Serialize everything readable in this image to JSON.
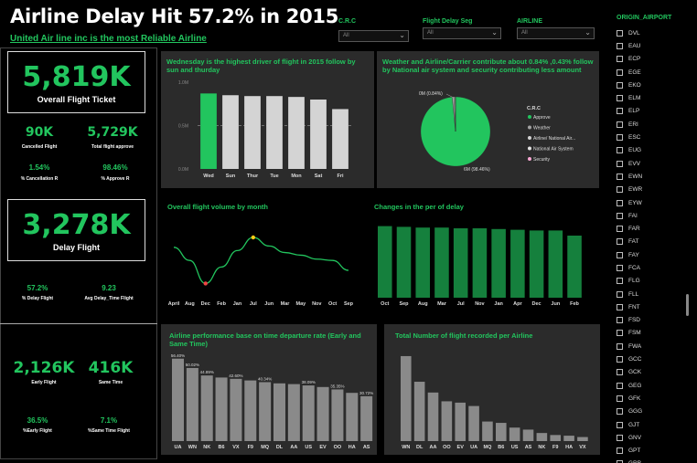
{
  "header": {
    "title": "Airline Delay Hit 57.2% in 2015",
    "subtitle": "United Air line inc is the most Reliable Airline"
  },
  "slicers": [
    {
      "label": "C.R.C",
      "value": "All"
    },
    {
      "label": "Flight Delay Seg",
      "value": "All"
    },
    {
      "label": "AIRLINE",
      "value": "All"
    }
  ],
  "kpis": {
    "overall_ticket": {
      "value": "5,819K",
      "label": "Overall Flight Ticket"
    },
    "cancelled": {
      "value": "90K",
      "label": "Cancelled Flight"
    },
    "approved": {
      "value": "5,729K",
      "label": "Total flight approve"
    },
    "cancel_rate": {
      "value": "1.54%",
      "label": "% Cancellation R"
    },
    "approve_rate": {
      "value": "98.46%",
      "label": "% Approve R"
    },
    "delay_flight": {
      "value": "3,278K",
      "label": "Delay Flight"
    },
    "delay_pct": {
      "value": "57.2%",
      "label": "% Delay Flight"
    },
    "avg_delay": {
      "value": "9.23",
      "label": "Avg Delay_Time Flight"
    },
    "early": {
      "value": "2,126K",
      "label": "Early Flight"
    },
    "same_time": {
      "value": "416K",
      "label": "Same Time"
    },
    "early_pct": {
      "value": "36.5%",
      "label": "%Early Flight"
    },
    "same_pct": {
      "value": "7.1%",
      "label": "%Same Time Flight"
    }
  },
  "panels": {
    "weekday_title": "Wednesday is the highest driver of flight in 2015 follow by sun and thurday",
    "pie_title": "Weather and Airline/Carrier contribute about 0.84% ,0.43% follow by National air system and security contributing less amount",
    "month_title": "Overall flight volume by month",
    "delay_change_title": "Changes in the per of delay",
    "perf_title": "Airline performance base on time departure rate (Early and Same Time)",
    "count_title": "Total Number of flight recorded per Airline"
  },
  "sidebar": {
    "title": "ORIGIN_AIRPORT",
    "items": [
      "DVL",
      "EAU",
      "ECP",
      "EGE",
      "EKO",
      "ELM",
      "ELP",
      "ERI",
      "ESC",
      "EUG",
      "EVV",
      "EWN",
      "EWR",
      "EYW",
      "FAI",
      "FAR",
      "FAT",
      "FAY",
      "FCA",
      "FLG",
      "FLL",
      "FNT",
      "FSD",
      "FSM",
      "FWA",
      "GCC",
      "GCK",
      "GEG",
      "GFK",
      "GGG",
      "GJT",
      "GNV",
      "GPT",
      "GRB",
      "GRI"
    ]
  },
  "colors": {
    "accent": "#22c55e",
    "bar_gray": "#8a8a8a",
    "bar_light": "#d4d4d4",
    "panel": "#2b2b2b"
  },
  "chart_data": [
    {
      "type": "bar",
      "title": "Wednesday is the highest driver of flight in 2015 follow by sun and thurday",
      "categories": [
        "Wed",
        "Sun",
        "Thur",
        "Tue",
        "Mon",
        "Sat",
        "Fri"
      ],
      "values": [
        0.87,
        0.85,
        0.84,
        0.84,
        0.83,
        0.8,
        0.69
      ],
      "y_tick_labels": [
        "1.0M",
        "0.5M",
        "0.0M"
      ],
      "ylim": [
        0,
        1.0
      ],
      "reference_line_label": "",
      "highlight": "Wed"
    },
    {
      "type": "pie",
      "title": "Weather and Airline/Carrier contribute about 0.84% ,0.43% follow by National air system and security contributing less amount",
      "legend_title": "C.R.C",
      "legend": [
        "Approve",
        "Weather",
        "Airline/ National Air...",
        "National Air System",
        "Security"
      ],
      "values": [
        98.46,
        0.84,
        0.43,
        0.25,
        0.02
      ],
      "data_labels": [
        "6M (98.46%)",
        "0M (0.84%)"
      ],
      "colors": [
        "#22c55e",
        "#a3a3a3",
        "#d4d4d4",
        "#e5e5e5",
        "#f9a8d4"
      ]
    },
    {
      "type": "line",
      "title": "Overall flight volume by month",
      "categories": [
        "April",
        "Aug",
        "Dec",
        "Feb",
        "Jan",
        "Jul",
        "Jun",
        "Mar",
        "May",
        "Nov",
        "Oct",
        "Sep"
      ],
      "values": [
        0.6,
        0.4,
        0.05,
        0.3,
        0.55,
        0.75,
        0.62,
        0.52,
        0.48,
        0.42,
        0.4,
        0.25
      ],
      "ylim": [
        0,
        1
      ]
    },
    {
      "type": "bar",
      "title": "Changes in the per of delay",
      "categories": [
        "Oct",
        "Sep",
        "Aug",
        "Mar",
        "Jul",
        "Nov",
        "Jan",
        "Apr",
        "Dec",
        "Jun",
        "Feb"
      ],
      "values": [
        0.98,
        0.97,
        0.96,
        0.96,
        0.95,
        0.95,
        0.94,
        0.93,
        0.92,
        0.92,
        0.85
      ],
      "ylim": [
        0,
        1
      ]
    },
    {
      "type": "bar",
      "title": "Airline performance base on time departure rate (Early and Same Time)",
      "categories": [
        "UA",
        "WN",
        "NK",
        "B6",
        "VX",
        "F9",
        "MQ",
        "DL",
        "AA",
        "US",
        "EV",
        "OO",
        "HA",
        "AS"
      ],
      "values": [
        56.4,
        50.02,
        44.89,
        43.5,
        42.6,
        41.5,
        40.34,
        39.5,
        39.0,
        38.09,
        37.0,
        35.35,
        33.0,
        30.72
      ],
      "data_labels": [
        "56.40%",
        "50.02%",
        "44.89%",
        "",
        "42.60%",
        "",
        "40.34%",
        "",
        "",
        "38.09%",
        "",
        "35.35%",
        "",
        "30.72%"
      ],
      "ylim": [
        0,
        60
      ]
    },
    {
      "type": "bar",
      "title": "Total Number of flight recorded per Airline",
      "categories": [
        "WN",
        "DL",
        "AA",
        "OO",
        "EV",
        "UA",
        "MQ",
        "B6",
        "US",
        "AS",
        "NK",
        "F9",
        "HA",
        "VX"
      ],
      "values": [
        1.26,
        0.88,
        0.72,
        0.59,
        0.57,
        0.52,
        0.29,
        0.27,
        0.2,
        0.17,
        0.12,
        0.09,
        0.08,
        0.06
      ],
      "ylim": [
        0,
        1.3
      ]
    }
  ]
}
